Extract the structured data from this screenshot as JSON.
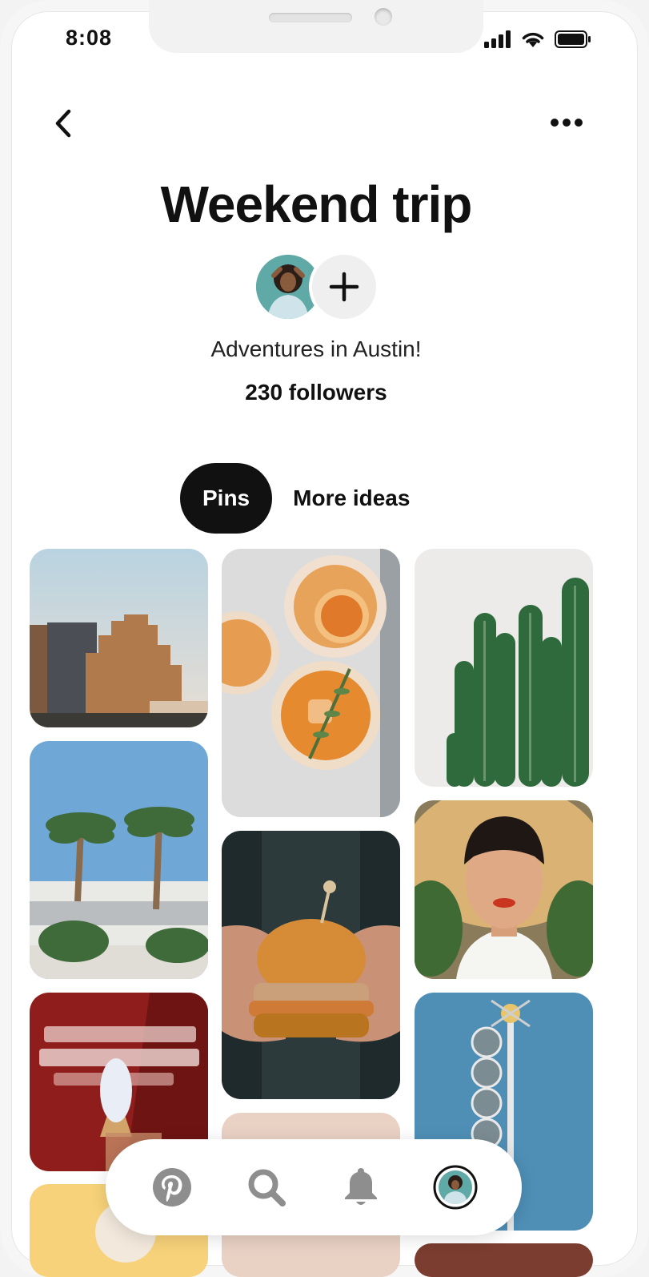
{
  "status_bar": {
    "time": "8:08"
  },
  "header": {
    "back_icon": "chevron-left-icon",
    "more_icon": "ellipsis-icon"
  },
  "board": {
    "title": "Weekend trip",
    "description": "Adventures in Austin!",
    "followers": "230 followers"
  },
  "tabs": [
    {
      "label": "Pins",
      "active": true
    },
    {
      "label": "More ideas",
      "active": false
    }
  ],
  "pins": [
    "austin-skyline",
    "cocktails",
    "cactus",
    "palm-trees",
    "burger",
    "woman-in-hat",
    "connors-creamery",
    "motel-sign"
  ],
  "bottom_nav": [
    {
      "icon": "pinterest-logo-icon"
    },
    {
      "icon": "search-icon"
    },
    {
      "icon": "bell-icon"
    },
    {
      "icon": "profile-avatar-icon"
    }
  ],
  "colors": {
    "active_tab_bg": "#111111",
    "nav_icon": "#8e8e8e"
  }
}
